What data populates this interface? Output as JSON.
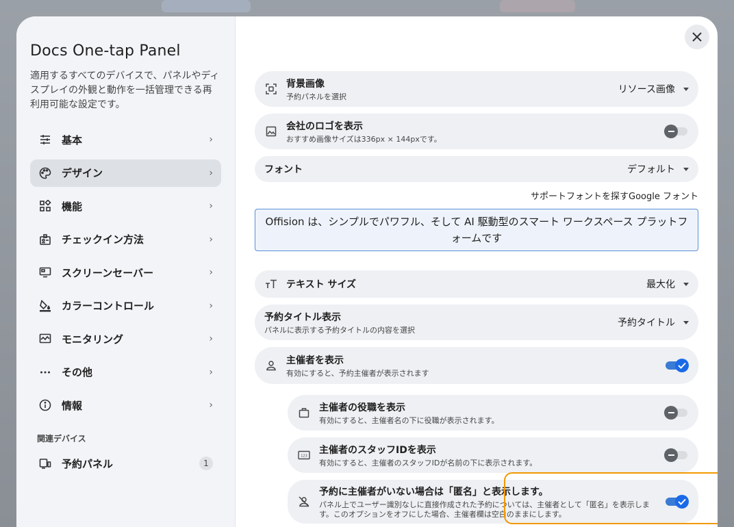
{
  "sidebar": {
    "title": "Docs One-tap Panel",
    "description": "適用するすべてのデバイスで、パネルやディスプレイの外観と動作を一括管理できる再利用可能な設定です。",
    "items": [
      {
        "label": "基本",
        "icon": "tune-icon"
      },
      {
        "label": "デザイン",
        "icon": "palette-icon"
      },
      {
        "label": "機能",
        "icon": "widgets-icon"
      },
      {
        "label": "チェックイン方法",
        "icon": "badge-icon"
      },
      {
        "label": "スクリーンセーバー",
        "icon": "monitor-icon"
      },
      {
        "label": "カラーコントロール",
        "icon": "format-color-fill-icon"
      },
      {
        "label": "モニタリング",
        "icon": "monitoring-icon"
      },
      {
        "label": "その他",
        "icon": "more-horiz-icon"
      },
      {
        "label": "情報",
        "icon": "info-icon"
      }
    ],
    "related_label": "関連デバイス",
    "related_item": {
      "label": "予約パネル",
      "count": "1"
    }
  },
  "main": {
    "background_image": {
      "title": "背景画像",
      "subtitle": "予約パネルを選択",
      "value": "リソース画像"
    },
    "show_logo": {
      "title": "会社のロゴを表示",
      "subtitle": "おすすめ画像サイズは336px × 144pxです。",
      "on": false
    },
    "font": {
      "title": "フォント",
      "value": "デフォルト"
    },
    "font_hint": "サポートフォントを探すGoogle フォント",
    "preview_text": "Offision は、シンプルでパワフル、そして AI 駆動型のスマート ワークスペース プラットフォームです",
    "text_size": {
      "title": "テキスト サイズ",
      "value": "最大化"
    },
    "title_display": {
      "title": "予約タイトル表示",
      "subtitle": "パネルに表示する予約タイトルの内容を選択",
      "value": "予約タイトル"
    },
    "show_organizer": {
      "title": "主催者を表示",
      "subtitle": "有効にすると、予約主催者が表示されます",
      "on": true
    },
    "organizer_role": {
      "title": "主催者の役職を表示",
      "subtitle": "有効にすると、主催者名の下に役職が表示されます。",
      "on": false
    },
    "organizer_staff_id": {
      "title": "主催者のスタッフIDを表示",
      "subtitle": "有効にすると、主催者のスタッフIDが名前の下に表示されます。",
      "on": false
    },
    "anonymous": {
      "title": "予約に主催者がいない場合は「匿名」と表示します。",
      "subtitle": "パネル上でユーザー識別なしに直接作成された予約については、主催者として「匿名」を表示します。このオプションをオフにした場合、主催者欄は空白のままにします。",
      "on": true
    }
  },
  "colors": {
    "accent": "#1a6ae8",
    "highlight": "#f29900",
    "sidebar_bg": "#f2f4f7"
  }
}
